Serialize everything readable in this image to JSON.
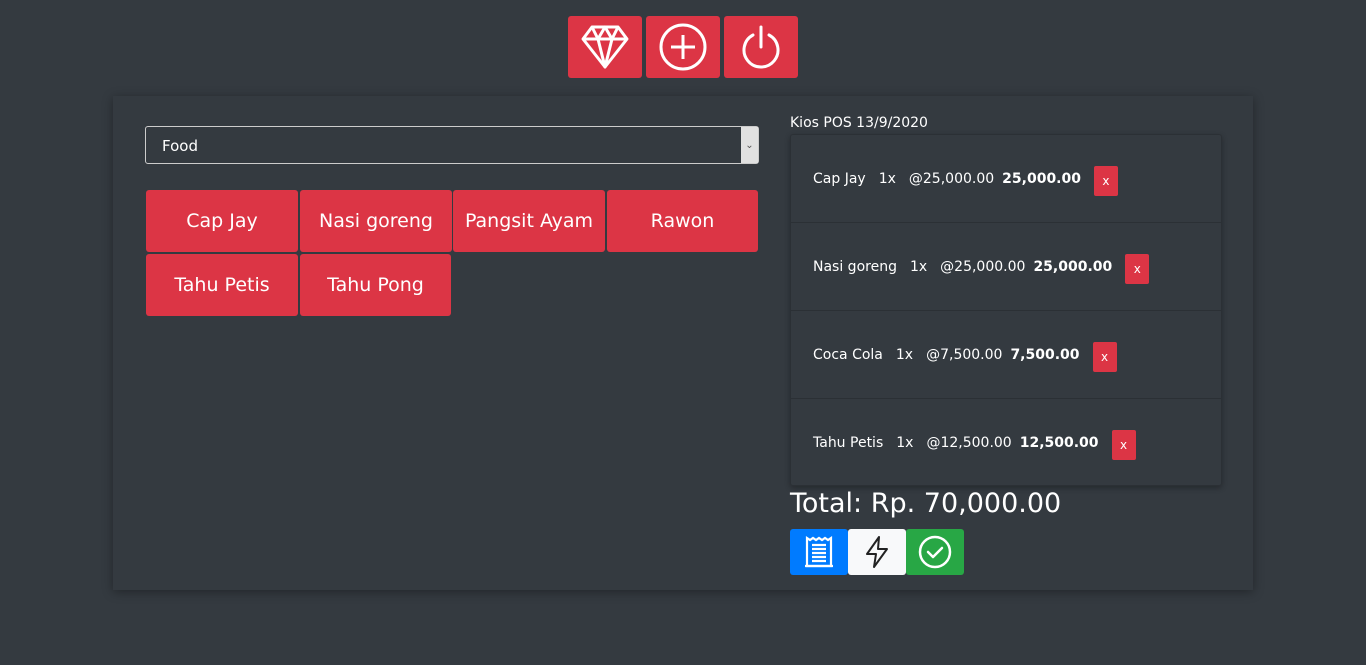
{
  "toolbar": {
    "icons": [
      "diamond-icon",
      "plus-circle-icon",
      "power-icon"
    ],
    "accent": "#dc3545"
  },
  "category": {
    "selected": "Food"
  },
  "products": [
    "Cap Jay",
    "Nasi goreng",
    "Pangsit Ayam",
    "Rawon",
    "Tahu Petis",
    "Tahu Pong"
  ],
  "cart": {
    "title": "Kios POS 13/9/2020",
    "items": [
      {
        "name": "Cap Jay",
        "qty": "1x",
        "price": "@25,000.00",
        "subtotal": "25,000.00",
        "remove": "x"
      },
      {
        "name": "Nasi goreng",
        "qty": "1x",
        "price": "@25,000.00",
        "subtotal": "25,000.00",
        "remove": "x"
      },
      {
        "name": "Coca Cola",
        "qty": "1x",
        "price": "@7,500.00",
        "subtotal": "7,500.00",
        "remove": "x"
      },
      {
        "name": "Tahu Petis",
        "qty": "1x",
        "price": "@12,500.00",
        "subtotal": "12,500.00",
        "remove": "x"
      }
    ],
    "total": "Total: Rp. 70,000.00"
  },
  "actions": {
    "icons": [
      "receipt-icon",
      "lightning-icon",
      "check-circle-icon"
    ],
    "colors": [
      "#007bff",
      "#f8f9fa",
      "#28a745"
    ]
  }
}
